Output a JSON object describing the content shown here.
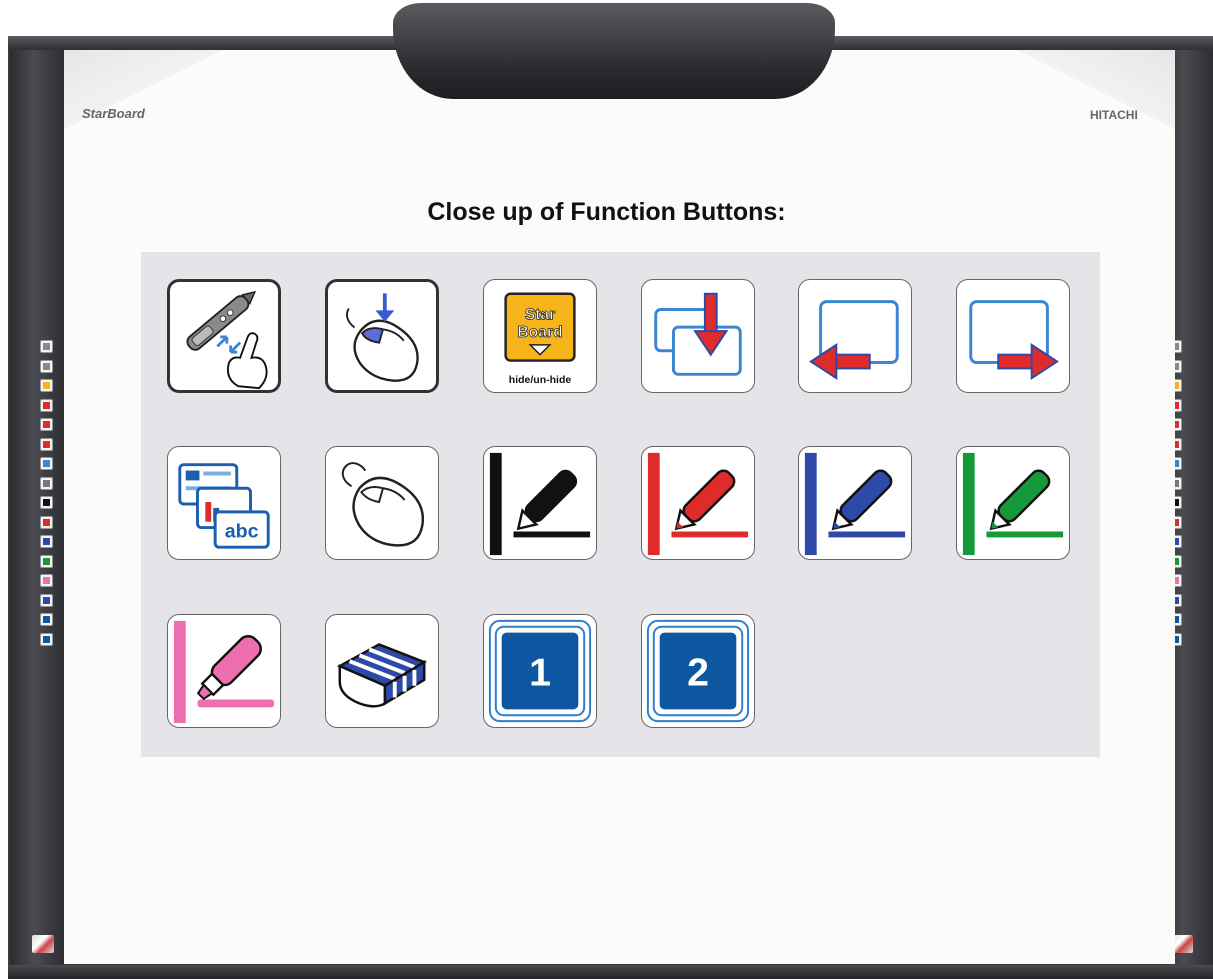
{
  "board": {
    "brand_left": "StarBoard",
    "brand_right": "HITACHI"
  },
  "heading": "Close up of Function Buttons:",
  "buttons": [
    {
      "icon": "pen-finger-switch-icon"
    },
    {
      "icon": "mouse-click-icon"
    },
    {
      "icon": "starboard-hide-icon",
      "line1": "Star",
      "line2": "Board",
      "caption": "hide/un-hide"
    },
    {
      "icon": "page-insert-icon"
    },
    {
      "icon": "page-previous-icon"
    },
    {
      "icon": "page-next-icon"
    },
    {
      "icon": "capture-abc-icon",
      "text": "abc"
    },
    {
      "icon": "mouse-icon"
    },
    {
      "icon": "pen-black-icon",
      "color": "#111111"
    },
    {
      "icon": "pen-red-icon",
      "color": "#e02b2b"
    },
    {
      "icon": "pen-blue-icon",
      "color": "#2e4aa8"
    },
    {
      "icon": "pen-green-icon",
      "color": "#159a3a"
    },
    {
      "icon": "highlighter-pink-icon",
      "color": "#ee6fb0"
    },
    {
      "icon": "eraser-icon"
    },
    {
      "icon": "screen-1-icon",
      "label": "1"
    },
    {
      "icon": "screen-2-icon",
      "label": "2"
    }
  ]
}
